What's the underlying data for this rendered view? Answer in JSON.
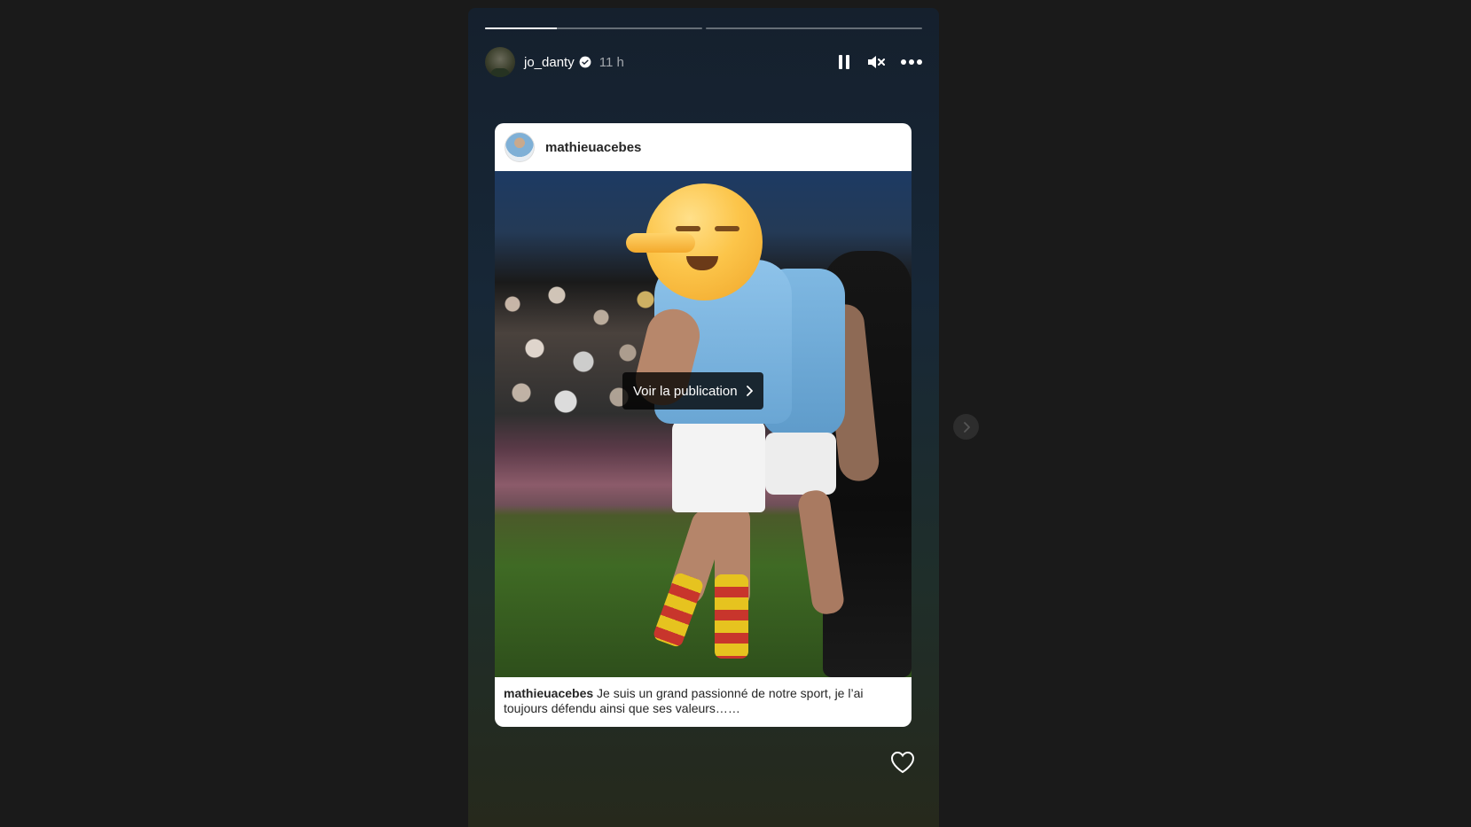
{
  "story": {
    "progress": [
      0.33,
      0
    ],
    "author": {
      "username": "jo_danty",
      "verified": true,
      "time": "11 h"
    },
    "controls": {
      "pause_icon": "pause-icon",
      "mute_icon": "speaker-muted-icon",
      "more_icon": "more-horizontal-icon"
    },
    "shared_post": {
      "username": "mathieuacebes",
      "cta_label": "Voir la publication",
      "caption_user": "mathieuacebes",
      "caption_text": " Je suis un grand passionné de notre sport, je l’ai toujours défendu ainsi que ses valeurs……"
    },
    "like_icon": "heart-icon"
  },
  "navigation": {
    "next_icon": "chevron-right-icon"
  },
  "colors": {
    "page_bg": "#1a1a1a",
    "story_bg_top": "#15202d",
    "story_bg_bottom": "#26291c",
    "verified_badge": "#ffffff"
  }
}
